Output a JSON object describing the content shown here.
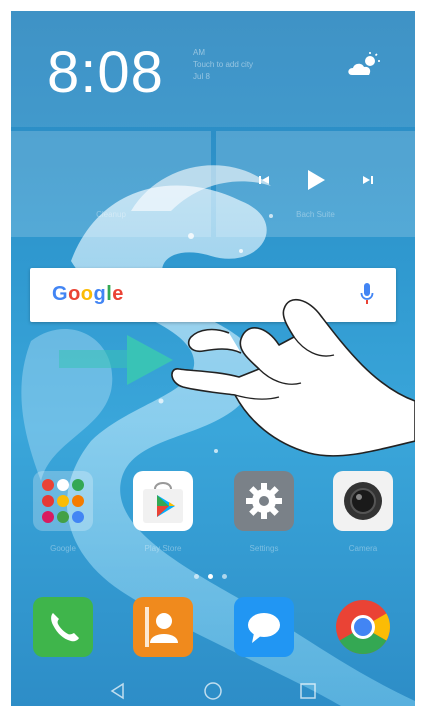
{
  "clock": {
    "time": "8:08",
    "weather_line1": "AM",
    "weather_line2": "Touch to add city",
    "weather_line3": "Jul 8",
    "weather_icon": "partly-sunny-icon"
  },
  "widgets": {
    "left_caption": "Cleanup",
    "right_caption": "Bach Suite"
  },
  "search": {
    "logo": "Google",
    "mic_icon": "mic-icon"
  },
  "apps_row": [
    {
      "name": "Google",
      "icon": "google-folder-icon"
    },
    {
      "name": "Play Store",
      "icon": "play-store-icon"
    },
    {
      "name": "Settings",
      "icon": "gear-icon"
    },
    {
      "name": "Camera",
      "icon": "camera-icon"
    }
  ],
  "page_dots": {
    "count": 3,
    "active": 1
  },
  "dock": [
    {
      "name": "Phone",
      "icon": "phone-icon"
    },
    {
      "name": "Contacts",
      "icon": "contacts-icon"
    },
    {
      "name": "Messaging",
      "icon": "messaging-icon"
    },
    {
      "name": "Chrome",
      "icon": "chrome-icon"
    }
  ],
  "navbar": [
    "back-icon",
    "home-icon",
    "recents-icon"
  ],
  "colors": {
    "arrow": "#39c3b6",
    "phone_app": "#3fb54b",
    "contacts_app": "#f08a1d",
    "messaging_app": "#2196f3"
  }
}
